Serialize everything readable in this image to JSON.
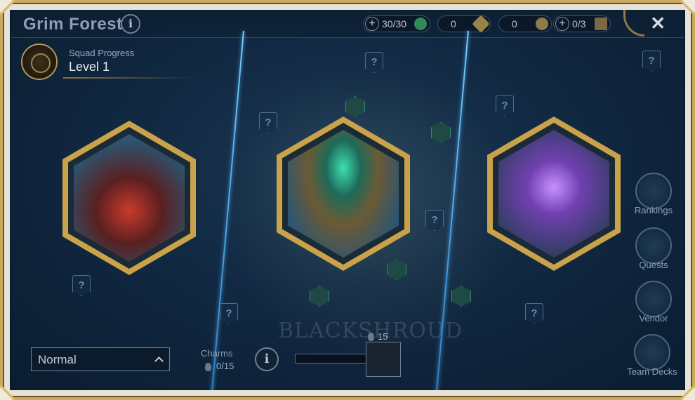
{
  "header": {
    "title": "Grim Forest",
    "info": "i",
    "close": "✕"
  },
  "resources": [
    {
      "value": "30/30",
      "icon": "energy-icon",
      "color": "#3aa86e",
      "has_plus": true
    },
    {
      "value": "0",
      "icon": "shard-icon",
      "color": "#b49a58",
      "has_plus": false
    },
    {
      "value": "0",
      "icon": "mask-icon",
      "color": "#b49a58",
      "has_plus": false
    },
    {
      "value": "0/3",
      "icon": "key-icon",
      "color": "#b49a58",
      "has_plus": true
    }
  ],
  "squad": {
    "label": "Squad Progress",
    "level": "Level 1"
  },
  "encounters": [
    {
      "name": "shrine-encounter",
      "accent": "#c93a2c"
    },
    {
      "name": "cauldron-encounter",
      "accent": "#3ee0b0"
    },
    {
      "name": "crystal-encounter",
      "accent": "#a060e8"
    }
  ],
  "side_menu": {
    "rankings": "Rankings",
    "quests": "Quests",
    "vendor": "Vendor",
    "team_decks": "Team Decks"
  },
  "footer": {
    "difficulty": "Normal",
    "charms_label": "Charms",
    "charms_value": "0/15",
    "reward_value": "15",
    "map_text": "BLACKSHROUD"
  },
  "unknown_marker": "?"
}
